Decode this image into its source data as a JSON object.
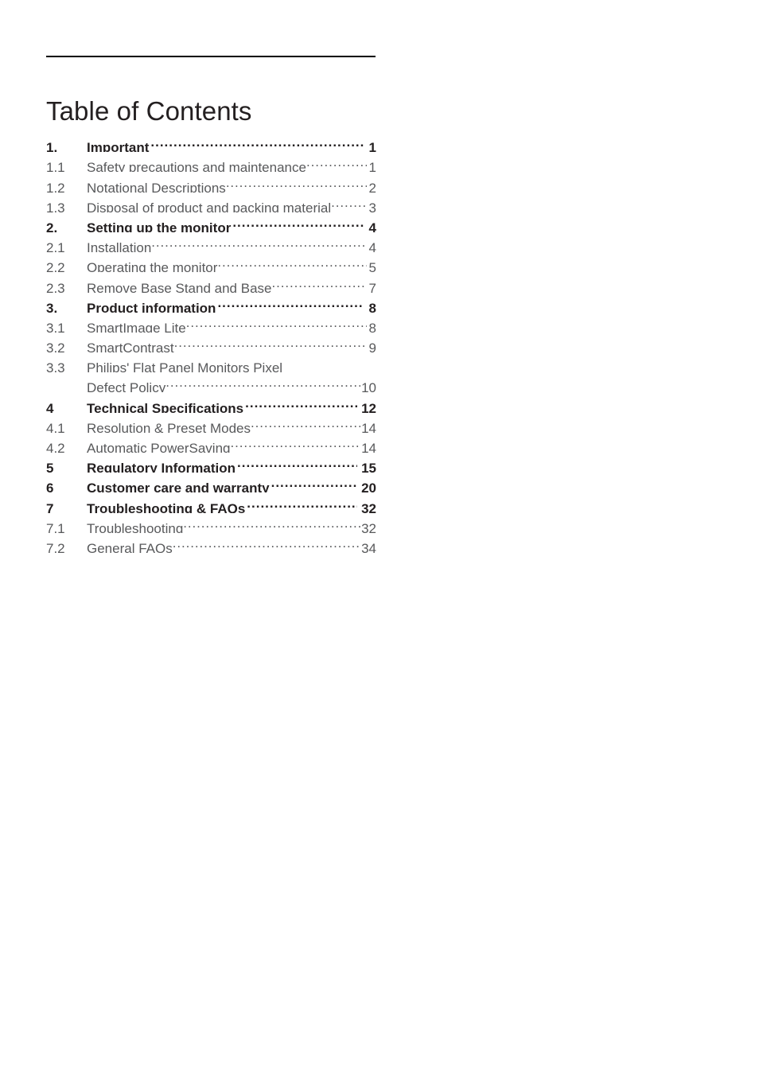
{
  "document": {
    "title": "Table of Contents"
  },
  "toc": {
    "entries": [
      {
        "number": "1.",
        "label": "Important",
        "page": "1",
        "level": 1
      },
      {
        "number": "1.1",
        "label": "Safety precautions and maintenance",
        "page": "1",
        "level": 2
      },
      {
        "number": "1.2",
        "label": "Notational Descriptions",
        "page": "2",
        "level": 2
      },
      {
        "number": "1.3",
        "label": "Disposal of product and packing material",
        "page": "3",
        "level": 2
      },
      {
        "number": "2.",
        "label": "Setting up the monitor",
        "page": "4",
        "level": 1
      },
      {
        "number": "2.1",
        "label": "Installation",
        "page": "4",
        "level": 2
      },
      {
        "number": "2.2",
        "label": "Operating the monitor",
        "page": "5",
        "level": 2
      },
      {
        "number": "2.3",
        "label": "Remove Base Stand and Base",
        "page": "7",
        "level": 2
      },
      {
        "number": "3.",
        "label": "Product information",
        "page": "8",
        "level": 1
      },
      {
        "number": "3.1",
        "label": "SmartImage Lite",
        "page": "8",
        "level": 2
      },
      {
        "number": "3.2",
        "label": "SmartContrast",
        "page": "9",
        "level": 2
      },
      {
        "number": "3.3",
        "label": "Philips' Flat Panel Monitors Pixel",
        "page": "",
        "level": 2,
        "wrapped_first": true
      },
      {
        "number": "",
        "label": "Defect Policy",
        "page": "10",
        "level": 2
      },
      {
        "number": "4",
        "label": "Technical Specifications",
        "page": "12",
        "level": 1
      },
      {
        "number": "4.1",
        "label": "Resolution & Preset Modes",
        "page": "14",
        "level": 2
      },
      {
        "number": "4.2",
        "label": "Automatic PowerSaving",
        "page": "14",
        "level": 2
      },
      {
        "number": "5",
        "label": "Regulatory Information",
        "page": "15",
        "level": 1
      },
      {
        "number": "6",
        "label": "Customer care and warranty",
        "page": "20",
        "level": 1
      },
      {
        "number": "7",
        "label": "Troubleshooting & FAQs",
        "page": "32",
        "level": 1
      },
      {
        "number": "7.1",
        "label": "Troubleshooting",
        "page": "32",
        "level": 2
      },
      {
        "number": "7.2",
        "label": "General FAQs",
        "page": "34",
        "level": 2
      }
    ]
  },
  "colors": {
    "heading": "#231f20",
    "subentry": "#58595b",
    "rule": "#000000",
    "background": "#ffffff"
  }
}
